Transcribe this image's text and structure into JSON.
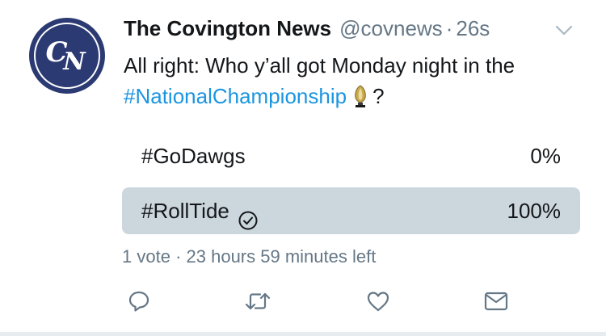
{
  "author": {
    "display_name": "The Covington News",
    "handle": "@covnews",
    "separator": "·",
    "time": "26s",
    "avatar_monogram": "CN"
  },
  "tweet": {
    "text_before": "All right: Who y’all got Monday night in the ",
    "hashtag": "#NationalChampionship",
    "text_after": "?",
    "emoji_icon": "trophy-icon"
  },
  "poll": {
    "options": [
      {
        "label": "#GoDawgs",
        "percent_label": "0%",
        "percent": 0,
        "selected": false
      },
      {
        "label": "#RollTide",
        "percent_label": "100%",
        "percent": 100,
        "selected": true
      }
    ],
    "votes": "1 vote",
    "separator": "·",
    "time_left": "23 hours 59 minutes left"
  },
  "actions": {
    "reply": "reply-icon",
    "retweet": "retweet-icon",
    "like": "heart-icon",
    "dm": "envelope-icon"
  },
  "colors": {
    "hashtag": "#1b95e0",
    "secondary_text": "#657786",
    "poll_fill": "#ccd6dd",
    "avatar_bg": "#2c3a73"
  }
}
